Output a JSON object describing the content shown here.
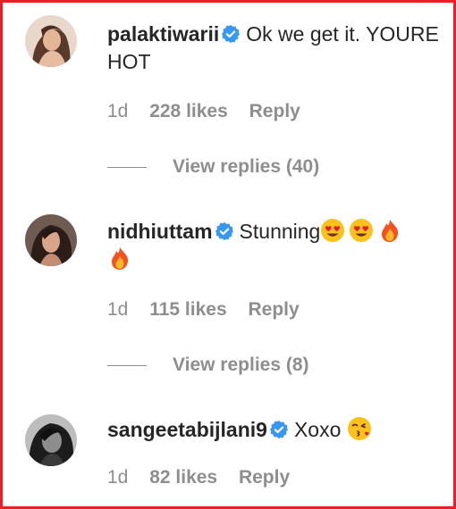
{
  "comments": [
    {
      "username": "palaktiwarii",
      "text": "Ok we get it. YOURE HOT",
      "time": "1d",
      "likes": "228 likes",
      "reply": "Reply",
      "view_replies": "View replies (40)"
    },
    {
      "username": "nidhiuttam",
      "text": "Stunning",
      "time": "1d",
      "likes": "115 likes",
      "reply": "Reply",
      "view_replies": "View replies (8)"
    },
    {
      "username": "sangeetabijlani9",
      "text": "Xoxo",
      "time": "1d",
      "likes": "82 likes",
      "reply": "Reply"
    }
  ],
  "colors": {
    "border": "#ee1d23",
    "verified": "#3897f0",
    "muted": "#8e8e8e",
    "text": "#262626"
  },
  "icons": [
    "verified-badge-icon",
    "heart-eyes-emoji-icon",
    "fire-emoji-icon",
    "kiss-emoji-icon"
  ]
}
